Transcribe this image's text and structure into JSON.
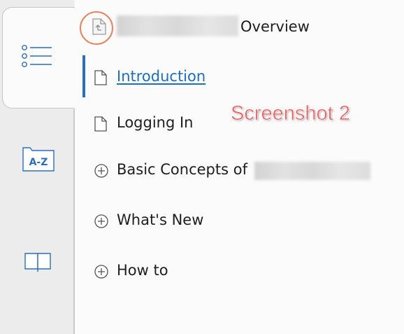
{
  "rail": {
    "tabs": [
      {
        "name": "contents",
        "icon": "list-icon",
        "active": true
      },
      {
        "name": "index",
        "icon": "index-az-icon",
        "label": "A-Z"
      },
      {
        "name": "glossary",
        "icon": "book-icon"
      }
    ]
  },
  "header": {
    "title": "Overview",
    "icon": "up-level-page-icon"
  },
  "nav": {
    "items": [
      {
        "label": "Introduction",
        "icon": "page-icon",
        "active": true
      },
      {
        "label": "Logging In",
        "icon": "page-icon"
      },
      {
        "label": "Basic Concepts of ",
        "icon": "plus-circle-icon"
      },
      {
        "label": "What's New",
        "icon": "plus-circle-icon"
      },
      {
        "label": "How to",
        "icon": "plus-circle-icon"
      }
    ]
  },
  "annotation": {
    "text": "Screenshot 2"
  },
  "colors": {
    "accent": "#2a6fbf",
    "link": "#1a6fc4",
    "highlight_circle": "#e8835d",
    "annotation": "#f05a5a"
  }
}
